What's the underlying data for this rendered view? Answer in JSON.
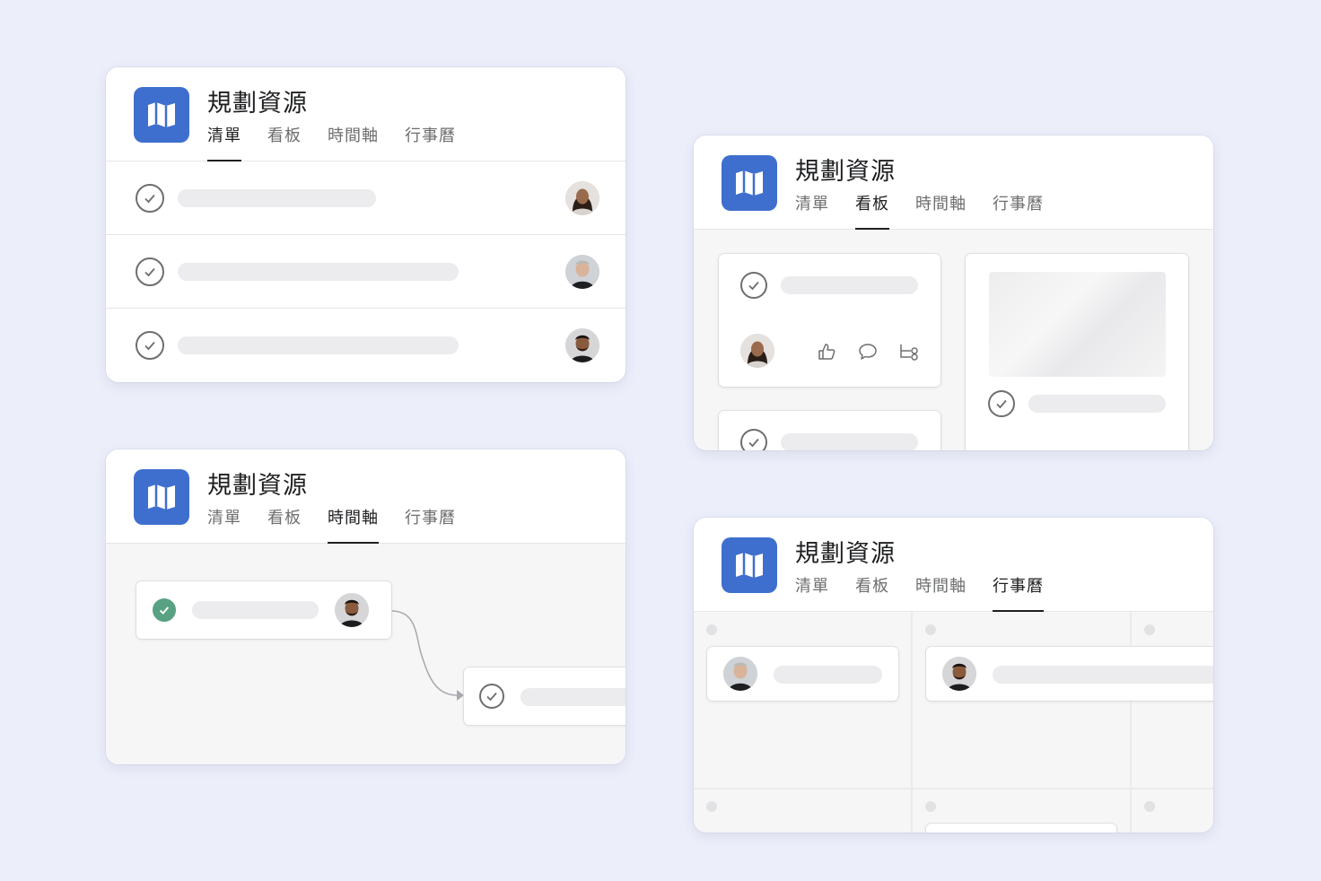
{
  "project": {
    "title": "規劃資源"
  },
  "tabs": {
    "list": "清單",
    "board": "看板",
    "timeline": "時間軸",
    "calendar": "行事曆"
  },
  "colors": {
    "background": "#eceefa",
    "icon_blue": "#3f6fce",
    "complete_green": "#58a182",
    "placeholder_bar": "#ececee"
  },
  "icons": {
    "project": "map-icon",
    "task": "check-circle-icon",
    "like": "thumbs-up-icon",
    "comment": "comment-icon",
    "subtasks": "subtask-icon"
  },
  "views": [
    "list",
    "board",
    "timeline",
    "calendar"
  ]
}
